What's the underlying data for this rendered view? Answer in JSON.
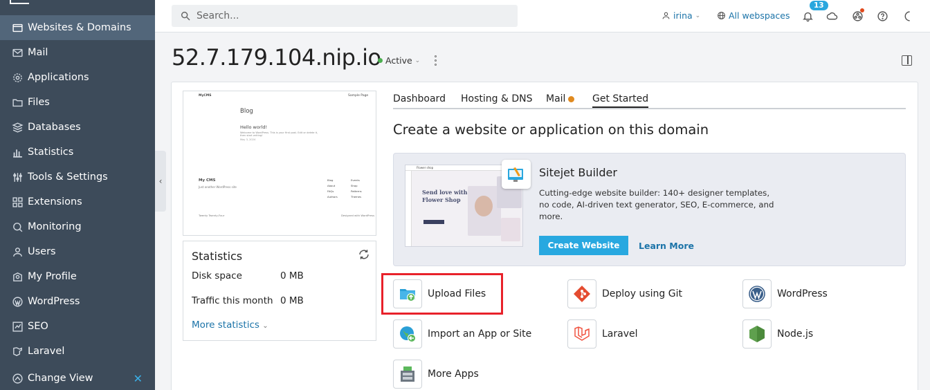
{
  "sidebar": {
    "items": [
      {
        "label": "Websites & Domains",
        "icon": "globe-icon",
        "active": true
      },
      {
        "label": "Mail",
        "icon": "mail-icon"
      },
      {
        "label": "Applications",
        "icon": "gear-icon"
      },
      {
        "label": "Files",
        "icon": "folder-icon"
      },
      {
        "label": "Databases",
        "icon": "database-icon"
      },
      {
        "label": "Statistics",
        "icon": "bar-chart-icon"
      },
      {
        "label": "Tools & Settings",
        "icon": "sliders-icon"
      },
      {
        "label": "Extensions",
        "icon": "puzzle-icon"
      },
      {
        "label": "Monitoring",
        "icon": "monitor-icon"
      },
      {
        "label": "Users",
        "icon": "user-icon"
      },
      {
        "label": "My Profile",
        "icon": "profile-icon"
      },
      {
        "label": "WordPress",
        "icon": "wordpress-icon"
      },
      {
        "label": "SEO",
        "icon": "seo-icon"
      },
      {
        "label": "Laravel",
        "icon": "laravel-icon"
      }
    ],
    "change_view": "Change View"
  },
  "header": {
    "search_placeholder": "Search...",
    "user": "irina",
    "webspaces": "All webspaces",
    "notifications_count": "13"
  },
  "page": {
    "title": "52.7.179.104.nip.io",
    "status": "Active"
  },
  "preview": {
    "site_name": "MyCMS",
    "nav": "Sample Page",
    "heading": "Blog",
    "post_title": "Hello world!",
    "post_text": "Welcome to WordPress. This is your first post. Edit or delete it, then start writing!",
    "post_date": "May 3, 2024",
    "footer_name": "My CMS",
    "footer_text": "Just another WordPress site",
    "col1": [
      "Blog",
      "About",
      "FAQs",
      "Authors"
    ],
    "col2": [
      "Events",
      "Shop",
      "Patterns",
      "Themes"
    ],
    "credit_left": "Twenty Twenty-Four",
    "credit_right": "Designed with WordPress"
  },
  "statistics": {
    "title": "Statistics",
    "rows": [
      {
        "label": "Disk space",
        "value": "0 MB"
      },
      {
        "label": "Traffic this month",
        "value": "0 MB"
      }
    ],
    "more": "More statistics"
  },
  "tabs": [
    "Dashboard",
    "Hosting & DNS",
    "Mail",
    "Get Started"
  ],
  "active_tab": "Get Started",
  "section_title": "Create a website or application on this domain",
  "promo": {
    "title": "Sitejet Builder",
    "description": "Cutting-edge website builder: 140+ designer templates, no code, AI-driven text generator, SEO, E-commerce, and more.",
    "create_button": "Create Website",
    "learn_more": "Learn More",
    "image_headline": "Send love with Flower Shop",
    "image_brand": "Flower shop"
  },
  "options": [
    {
      "label": "Upload Files",
      "icon": "upload-folder-icon"
    },
    {
      "label": "Deploy using Git",
      "icon": "git-icon"
    },
    {
      "label": "WordPress",
      "icon": "wordpress-icon"
    },
    {
      "label": "Import an App or Site",
      "icon": "import-globe-icon"
    },
    {
      "label": "Laravel",
      "icon": "laravel-icon"
    },
    {
      "label": "Node.js",
      "icon": "nodejs-icon"
    },
    {
      "label": "More Apps",
      "icon": "apps-icon"
    }
  ],
  "colors": {
    "sidebar_bg": "#3d4b5a",
    "sidebar_active": "#52667a",
    "accent": "#28a8e0",
    "link": "#1b73a8",
    "status_active": "#4caf50",
    "highlight": "#e8212a"
  }
}
